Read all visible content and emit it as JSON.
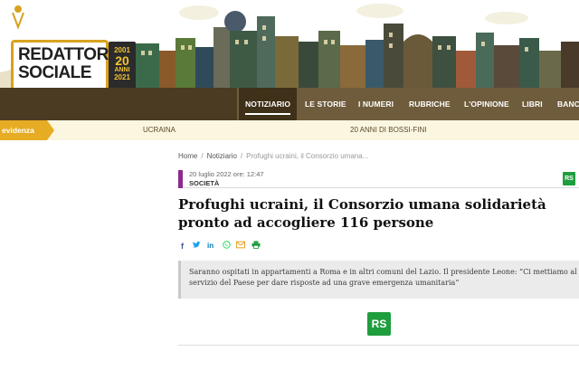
{
  "logo": {
    "line1": "REDATTORE",
    "line2": "SOCIALE",
    "year_start": "2001",
    "years": "20",
    "years_word": "ANNI",
    "year_end": "2021"
  },
  "nav": {
    "items": [
      "NOTIZIARIO",
      "LE STORIE",
      "I NUMERI",
      "RUBRICHE",
      "L'OPINIONE",
      "LIBRI",
      "BANC"
    ],
    "active_index": 0
  },
  "evidence": {
    "label": "evidenza",
    "links": [
      "UCRAINA",
      "20 ANNI DI BOSSI-FINI"
    ]
  },
  "breadcrumb": {
    "home": "Home",
    "section": "Notiziario",
    "current": "Profughi ucraini, il Consorzio umana..."
  },
  "article": {
    "date": "20 luglio 2022 ore: 12:47",
    "category": "SOCIETÀ",
    "title": "Profughi ucraini, il Consorzio umana solidarietà pronto ad accogliere 116 persone",
    "abstract": "Saranno ospitati in appartamenti a Roma e in altri comuni del Lazio. Il presidente Leone: “Ci mettiamo al servizio del Paese per dare risposte ad una grave emergenza umanitaria”",
    "badge": "RS"
  },
  "share": [
    {
      "name": "facebook-icon",
      "glyph": "f",
      "color": "#3b5998"
    },
    {
      "name": "twitter-icon",
      "glyph": "🐦",
      "color": "#1da1f2"
    },
    {
      "name": "linkedin-icon",
      "glyph": "in",
      "color": "#0077b5"
    },
    {
      "name": "whatsapp-icon",
      "glyph": "✆",
      "color": "#25d366"
    },
    {
      "name": "email-icon",
      "glyph": "✉",
      "color": "#e8a52a"
    },
    {
      "name": "print-icon",
      "glyph": "⎙",
      "color": "#1f9e3e"
    }
  ],
  "colors": {
    "nav_bg": "#6f5c3c",
    "nav_active": "#3e3019",
    "evidence_accent": "#e6ac24",
    "category_bar": "#8d2a8d",
    "rs_green": "#1f9e3e"
  }
}
